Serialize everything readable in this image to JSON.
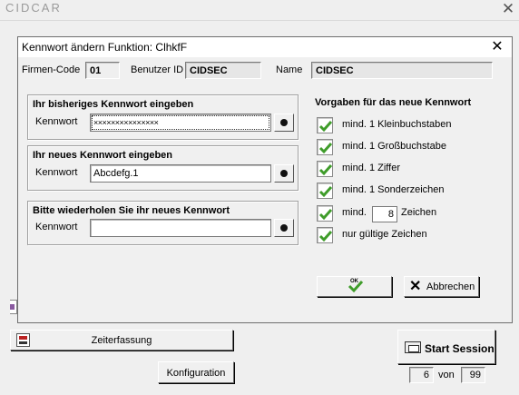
{
  "main_window": {
    "title": "CIDCAR",
    "close_glyph": "✕",
    "zeiterfassung_label": "Zeiterfassung",
    "konfiguration_label": "Konfiguration",
    "start_session_label": "Start Session",
    "page_current": "6",
    "page_of_label": "von",
    "page_total": "99"
  },
  "dialog": {
    "title": "Kennwort ändern  Funktion: ClhkfF",
    "close_glyph": "✕",
    "firmen_code_label": "Firmen-Code",
    "firmen_code_value": "01",
    "benutzer_id_label": "Benutzer ID",
    "benutzer_id_value": "CIDSEC",
    "name_label": "Name",
    "name_value": "CIDSEC",
    "old_password": {
      "title": "Ihr bisheriges Kennwort eingeben",
      "field_label": "Kennwort",
      "value": "×××××××××××××××"
    },
    "new_password": {
      "title": "Ihr neues Kennwort eingeben",
      "field_label": "Kennwort",
      "value": "Abcdefg.1"
    },
    "repeat_password": {
      "title": "Bitte wiederholen Sie ihr neues Kennwort",
      "field_label": "Kennwort",
      "value": ""
    },
    "rules_title": "Vorgaben für das neue Kennwort",
    "rules": [
      {
        "label": "mind. 1 Kleinbuchstaben",
        "checked": true
      },
      {
        "label": "mind. 1 Großbuchstabe",
        "checked": true
      },
      {
        "label": "mind. 1 Ziffer",
        "checked": true
      },
      {
        "label": "mind. 1 Sonderzeichen",
        "checked": true
      },
      {
        "label": "mind.",
        "suffix": "Zeichen",
        "value": "8",
        "checked": true
      },
      {
        "label": "nur gültige Zeichen",
        "checked": true
      }
    ],
    "ok_label": "OK",
    "cancel_label": "Abbrechen",
    "accent_check_color": "#3f9c2a"
  }
}
